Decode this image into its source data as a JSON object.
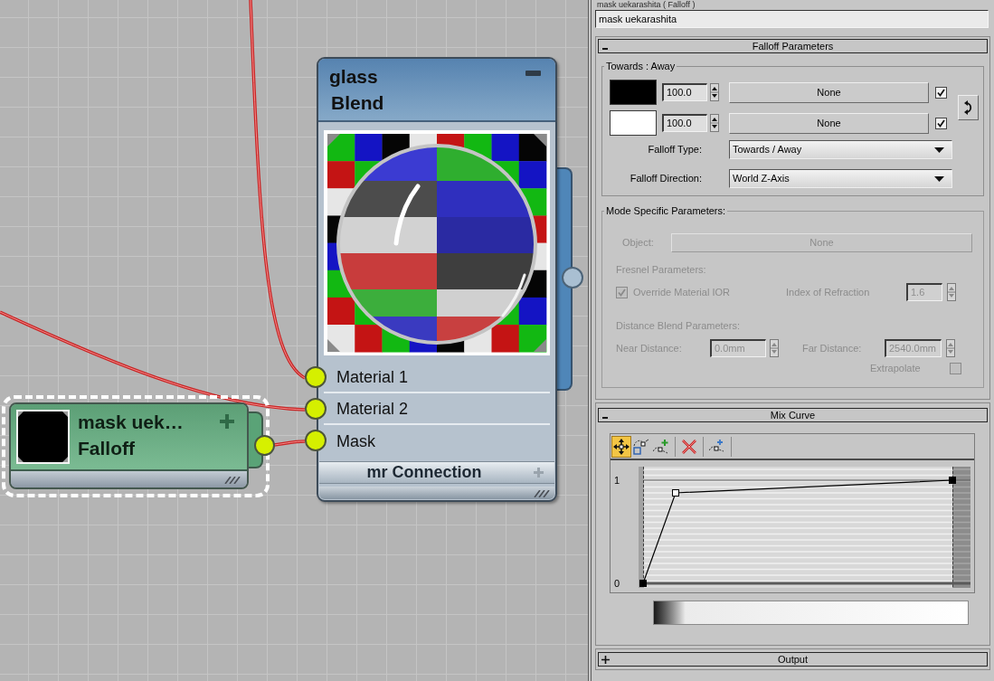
{
  "node_editor": {
    "nodes": [
      {
        "kind": "material",
        "selected": false,
        "name": "glass",
        "type": "Blend",
        "slots": [
          {
            "label": "Material 1"
          },
          {
            "label": "Material 2"
          },
          {
            "label": "Mask"
          }
        ],
        "footer": "mr Connection"
      },
      {
        "kind": "map",
        "selected": true,
        "name": "mask uek…",
        "type": "Falloff"
      }
    ]
  },
  "editor": {
    "title": "mask uekarashita ( Falloff )",
    "name": "mask uekarashita",
    "rollouts": [
      {
        "kind": "falloff",
        "title": "Falloff Parameters",
        "expanded": true,
        "towards_away": {
          "title": "Towards : Away",
          "rows": [
            {
              "color": "#000000",
              "amount": "100.0",
              "map": "None",
              "checked": true
            },
            {
              "color": "#ffffff",
              "amount": "100.0",
              "map": "None",
              "checked": true
            }
          ],
          "fields": [
            {
              "label": "Falloff Type:",
              "value": "Towards / Away"
            },
            {
              "label": "Falloff Direction:",
              "value": "World Z-Axis"
            }
          ]
        },
        "mode_specific": {
          "title": "Mode Specific Parameters:",
          "disabled": true,
          "object": {
            "label": "Object:",
            "value": "None"
          },
          "fresnel": {
            "title": "Fresnel Parameters:",
            "override": {
              "label": "Override Material IOR",
              "checked": true
            },
            "ior": {
              "label": "Index of Refraction",
              "value": "1.6"
            }
          },
          "distance": {
            "title": "Distance Blend Parameters:",
            "near": {
              "label": "Near Distance:",
              "value": "0.0mm"
            },
            "far": {
              "label": "Far Distance:",
              "value": "2540.0mm"
            },
            "extrapolate": {
              "label": "Extrapolate",
              "checked": false
            }
          }
        }
      },
      {
        "kind": "mix_curve",
        "title": "Mix Curve",
        "expanded": true,
        "tools": [
          {
            "kind": "move",
            "selected": true
          },
          {
            "kind": "scale",
            "selected": false
          },
          {
            "kind": "insert",
            "selected": false
          },
          {
            "kind": "delete",
            "selected": false
          },
          {
            "kind": "reset",
            "selected": false
          }
        ],
        "y_labels": [
          "1",
          "0"
        ]
      },
      {
        "kind": "output",
        "title": "Output",
        "expanded": false
      }
    ]
  }
}
